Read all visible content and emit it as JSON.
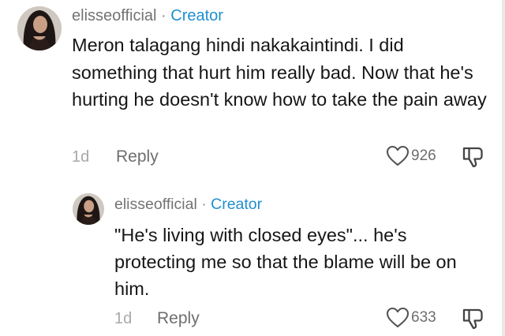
{
  "comments": [
    {
      "username": "elisseofficial",
      "separator": "·",
      "badge": "Creator",
      "text": "Meron talagang hindi nakakaintindi. I did something that hurt him really bad. Now that he's hurting he doesn't know how to take the pain away",
      "age": "1d",
      "reply_label": "Reply",
      "likes": "926",
      "avatar_icon": "profile-photo"
    },
    {
      "username": "elisseofficial",
      "separator": "·",
      "badge": "Creator",
      "text": "\"He's living with closed eyes\"... he's protecting me so that the blame will be on him.",
      "age": "1d",
      "reply_label": "Reply",
      "likes": "633",
      "avatar_icon": "profile-photo"
    }
  ],
  "icons": {
    "like": "heart-outline-icon",
    "dislike": "thumbs-down-icon"
  },
  "colors": {
    "creator_badge": "#1f8fcf",
    "body_text": "#161616",
    "meta_text": "#a8a8a8"
  }
}
